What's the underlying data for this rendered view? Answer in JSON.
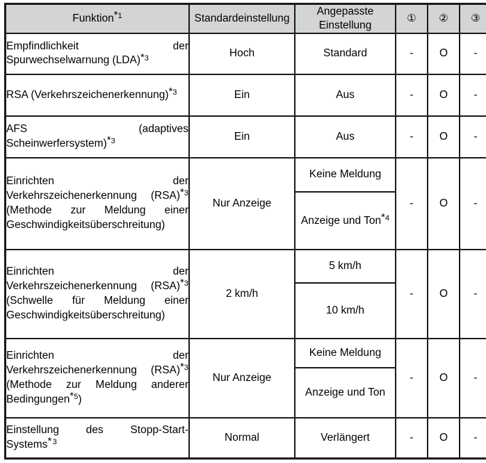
{
  "table": {
    "headers": {
      "function": "Funktion",
      "function_footnote": "*1",
      "default_setting": "Standardeinstellung",
      "custom_setting": "Angepasste Einstellung",
      "mark1": "①",
      "mark2": "②",
      "mark3": "③"
    },
    "colors": {
      "header_background": "#d2d4d5",
      "border": "#1a1a1a",
      "body_background": "#ffffff",
      "text": "#000000"
    },
    "rows": [
      {
        "function": "Empfindlichkeit der Spurwechselwarnung (LDA)",
        "function_footnote": "*3",
        "default_setting": "Hoch",
        "custom_settings": [
          "Standard"
        ],
        "custom_footnotes": [
          ""
        ],
        "mark1": "-",
        "mark2": "O",
        "mark3": "-"
      },
      {
        "function": "RSA (Verkehrszeichenerkennung)",
        "function_footnote": "*3",
        "default_setting": "Ein",
        "custom_settings": [
          "Aus"
        ],
        "custom_footnotes": [
          ""
        ],
        "mark1": "-",
        "mark2": "O",
        "mark3": "-"
      },
      {
        "function": "AFS (adaptives Scheinwerfersystem)",
        "function_footnote": "*3",
        "default_setting": "Ein",
        "custom_settings": [
          "Aus"
        ],
        "custom_footnotes": [
          ""
        ],
        "mark1": "-",
        "mark2": "O",
        "mark3": "-"
      },
      {
        "function": "Einrichten der Verkehrszeichenerkennung (RSA)",
        "function_footnote": "*3",
        "function_suffix": "(Methode zur Meldung einer Geschwindigkeitsüberschreitung)",
        "default_setting": "Nur Anzeige",
        "custom_settings": [
          "Keine Meldung",
          "Anzeige und Ton"
        ],
        "custom_footnotes": [
          "",
          "*4"
        ],
        "mark1": "-",
        "mark2": "O",
        "mark3": "-"
      },
      {
        "function": "Einrichten der Verkehrszeichenerkennung (RSA)",
        "function_footnote": "*3",
        "function_suffix": "(Schwelle für Meldung einer Geschwindigkeitsüberschreitung)",
        "default_setting": "2 km/h",
        "custom_settings": [
          "5 km/h",
          "10 km/h"
        ],
        "custom_footnotes": [
          "",
          ""
        ],
        "mark1": "-",
        "mark2": "O",
        "mark3": "-"
      },
      {
        "function": "Einrichten der Verkehrszeichenerkennung (RSA)",
        "function_footnote": "*3",
        "function_suffix": "(Methode zur Meldung anderer Bedingungen",
        "function_suffix_footnote": "*5",
        "function_suffix_tail": ")",
        "default_setting": "Nur Anzeige",
        "custom_settings": [
          "Keine Meldung",
          "Anzeige und Ton"
        ],
        "custom_footnotes": [
          "",
          ""
        ],
        "mark1": "-",
        "mark2": "O",
        "mark3": "-"
      },
      {
        "function": "Einstellung des Stopp-Start-Systems",
        "function_footnote": "*3",
        "default_setting": "Normal",
        "custom_settings": [
          "Verlängert"
        ],
        "custom_footnotes": [
          ""
        ],
        "mark1": "-",
        "mark2": "O",
        "mark3": "-"
      }
    ]
  }
}
